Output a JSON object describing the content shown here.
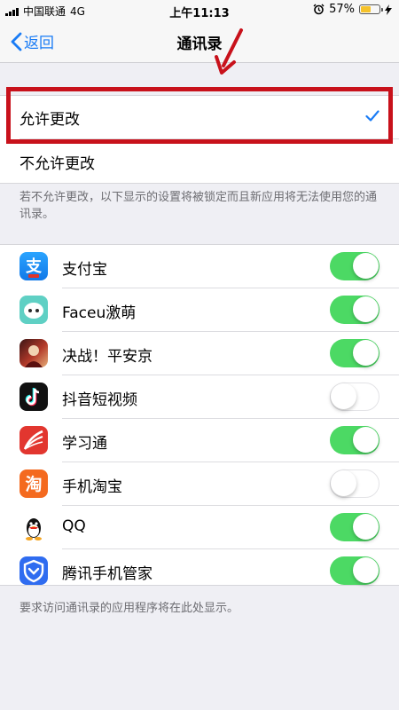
{
  "status": {
    "carrier": "中国联通",
    "network": "4G",
    "time": "上午11:13",
    "battery": "57%",
    "battery_level": 0.57
  },
  "nav": {
    "back_label": "返回",
    "title": "通讯录"
  },
  "options": [
    {
      "label": "允许更改",
      "checked": true
    },
    {
      "label": "不允许更改",
      "checked": false
    }
  ],
  "note_top": "若不允许更改，以下显示的设置将被锁定而且新应用将无法使用您的通讯录。",
  "apps": [
    {
      "name": "支付宝",
      "enabled": true,
      "icon": "alipay-icon",
      "color": "#1b8ff2"
    },
    {
      "name": "Faceu激萌",
      "enabled": true,
      "icon": "faceu-icon",
      "color": "#5fd0c4"
    },
    {
      "name": "决战！平安京",
      "enabled": true,
      "icon": "onmyoji-arena-icon",
      "color": "#7a1e1e"
    },
    {
      "name": "抖音短视频",
      "enabled": false,
      "icon": "douyin-icon",
      "color": "#111111"
    },
    {
      "name": "学习通",
      "enabled": true,
      "icon": "xuexitong-icon",
      "color": "#e2362f"
    },
    {
      "name": "手机淘宝",
      "enabled": false,
      "icon": "taobao-icon",
      "color": "#f46a1f"
    },
    {
      "name": "QQ",
      "enabled": true,
      "icon": "qq-icon",
      "color": "#ffffff"
    },
    {
      "name": "腾讯手机管家",
      "enabled": true,
      "icon": "tencent-guard-icon",
      "color": "#2f6cf0"
    }
  ],
  "note_bottom": "要求访问通讯录的应用程序将在此处显示。",
  "colors": {
    "accent": "#1a7cf5",
    "toggle_on": "#4cd964",
    "highlight": "#c8111b"
  }
}
